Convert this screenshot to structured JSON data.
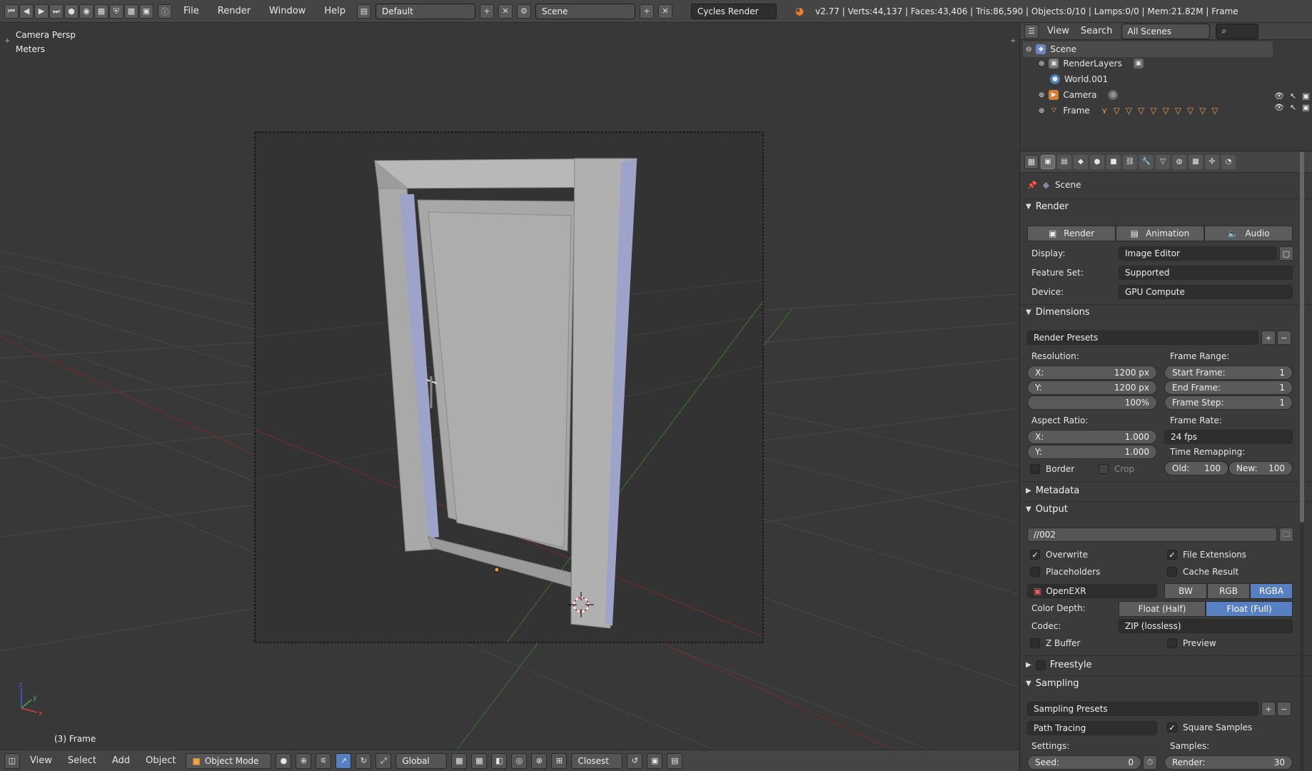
{
  "topbar": {
    "menus": [
      "File",
      "Render",
      "Window",
      "Help"
    ],
    "layout": "Default",
    "scene": "Scene",
    "engine": "Cycles Render",
    "stats": "v2.77 | Verts:44,137 | Faces:43,406 | Tris:86,590 | Objects:0/10 | Lamps:0/0 | Mem:21.82M | Frame"
  },
  "viewport": {
    "view_name": "Camera Persp",
    "units": "Meters",
    "object_label": "(3) Frame"
  },
  "view_header": {
    "menus": [
      "View",
      "Select",
      "Add",
      "Object"
    ],
    "mode": "Object Mode",
    "orientation": "Global",
    "snap": "Closest"
  },
  "outliner": {
    "menus": [
      "View",
      "Search"
    ],
    "scope": "All Scenes",
    "items": [
      {
        "label": "Scene"
      },
      {
        "label": "RenderLayers"
      },
      {
        "label": "World.001"
      },
      {
        "label": "Camera"
      },
      {
        "label": "Frame"
      }
    ]
  },
  "props": {
    "context": "Scene",
    "render": {
      "title": "Render",
      "buttons": [
        "Render",
        "Animation",
        "Audio"
      ],
      "display_label": "Display:",
      "display": "Image Editor",
      "feature_label": "Feature Set:",
      "feature": "Supported",
      "device_label": "Device:",
      "device": "GPU Compute"
    },
    "dimensions": {
      "title": "Dimensions",
      "presets": "Render Presets",
      "resolution_label": "Resolution:",
      "res_x_label": "X:",
      "res_x": "1200 px",
      "res_y_label": "Y:",
      "res_y": "1200 px",
      "res_pct": "100%",
      "frame_range_label": "Frame Range:",
      "start_label": "Start Frame:",
      "start": "1",
      "end_label": "End Frame:",
      "end": "1",
      "step_label": "Frame Step:",
      "step": "1",
      "aspect_label": "Aspect Ratio:",
      "asp_x_label": "X:",
      "asp_x": "1.000",
      "asp_y_label": "Y:",
      "asp_y": "1.000",
      "frame_rate_label": "Frame Rate:",
      "frame_rate": "24 fps",
      "time_remap_label": "Time Remapping:",
      "old_label": "Old:",
      "old": "100",
      "new_label": "New:",
      "new": "100",
      "border": "Border",
      "crop": "Crop"
    },
    "metadata": {
      "title": "Metadata"
    },
    "output": {
      "title": "Output",
      "path": "//002",
      "overwrite": "Overwrite",
      "file_ext": "File Extensions",
      "placeholders": "Placeholders",
      "cache": "Cache Result",
      "format": "OpenEXR",
      "channels": [
        "BW",
        "RGB",
        "RGBA"
      ],
      "depth_label": "Color Depth:",
      "depths": [
        "Float (Half)",
        "Float (Full)"
      ],
      "codec_label": "Codec:",
      "codec": "ZIP (lossless)",
      "zbuffer": "Z Buffer",
      "preview": "Preview"
    },
    "freestyle": {
      "title": "Freestyle"
    },
    "sampling": {
      "title": "Sampling",
      "presets": "Sampling Presets",
      "method": "Path Tracing",
      "square": "Square Samples",
      "settings_label": "Settings:",
      "samples_label": "Samples:",
      "seed_label": "Seed:",
      "seed": "0",
      "render_label": "Render:",
      "render": "30"
    }
  }
}
